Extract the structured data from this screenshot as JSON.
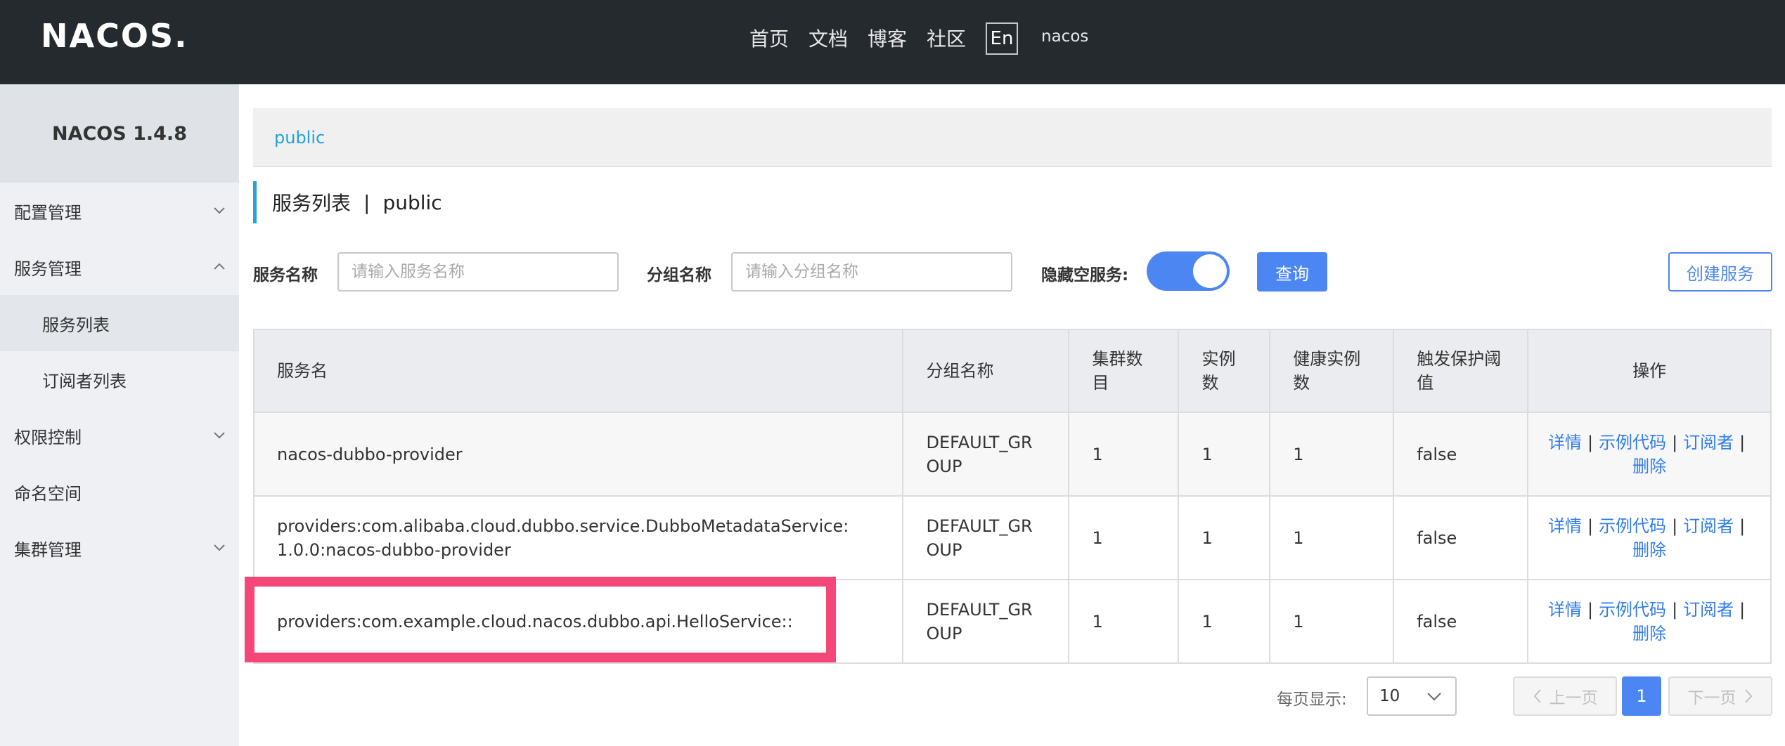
{
  "header": {
    "logo": "NACOS.",
    "nav": [
      "首页",
      "文档",
      "博客",
      "社区"
    ],
    "lang": "En",
    "user": "nacos"
  },
  "sidebar": {
    "title": "NACOS 1.4.8",
    "items": [
      {
        "label": "配置管理",
        "icon": "chevron-down-icon"
      },
      {
        "label": "服务管理",
        "icon": "chevron-up-icon"
      },
      {
        "label": "服务列表",
        "sub": true,
        "active": true
      },
      {
        "label": "订阅者列表",
        "sub": true
      },
      {
        "label": "权限控制",
        "icon": "chevron-down-icon"
      },
      {
        "label": "命名空间"
      },
      {
        "label": "集群管理",
        "icon": "chevron-down-icon"
      }
    ]
  },
  "namespace": {
    "link": "public"
  },
  "page_title": {
    "main": "服务列表",
    "sep": "|",
    "ns": "public"
  },
  "filters": {
    "service_label": "服务名称",
    "service_placeholder": "请输入服务名称",
    "group_label": "分组名称",
    "group_placeholder": "请输入分组名称",
    "hide_empty_label": "隐藏空服务:",
    "hide_empty_on": true,
    "query_btn": "查询",
    "create_btn": "创建服务"
  },
  "table": {
    "columns": [
      "服务名",
      "分组名称",
      "集群数目",
      "实例数",
      "健康实例数",
      "触发保护阈值",
      "操作"
    ],
    "rows": [
      {
        "name": "nacos-dubbo-provider",
        "group": "DEFAULT_GROUP",
        "clusters": "1",
        "instances": "1",
        "healthy": "1",
        "threshold": "false"
      },
      {
        "name": "providers:com.alibaba.cloud.dubbo.service.DubboMetadataService:1.0.0:nacos-dubbo-provider",
        "group": "DEFAULT_GROUP",
        "clusters": "1",
        "instances": "1",
        "healthy": "1",
        "threshold": "false"
      },
      {
        "name": "providers:com.example.cloud.nacos.dubbo.api.HelloService::",
        "group": "DEFAULT_GROUP",
        "clusters": "1",
        "instances": "1",
        "healthy": "1",
        "threshold": "false"
      }
    ],
    "ops": {
      "detail": "详情",
      "sample": "示例代码",
      "subscriber": "订阅者",
      "delete": "删除",
      "sep": "|"
    }
  },
  "pagination": {
    "per_page_label": "每页显示:",
    "per_page": "10",
    "prev": "上一页",
    "current": "1",
    "next": "下一页"
  },
  "colors": {
    "accent": "#4b86f2",
    "link": "#2f7ce8",
    "highlight": "#f5467a",
    "header_bg": "#252a2f"
  }
}
